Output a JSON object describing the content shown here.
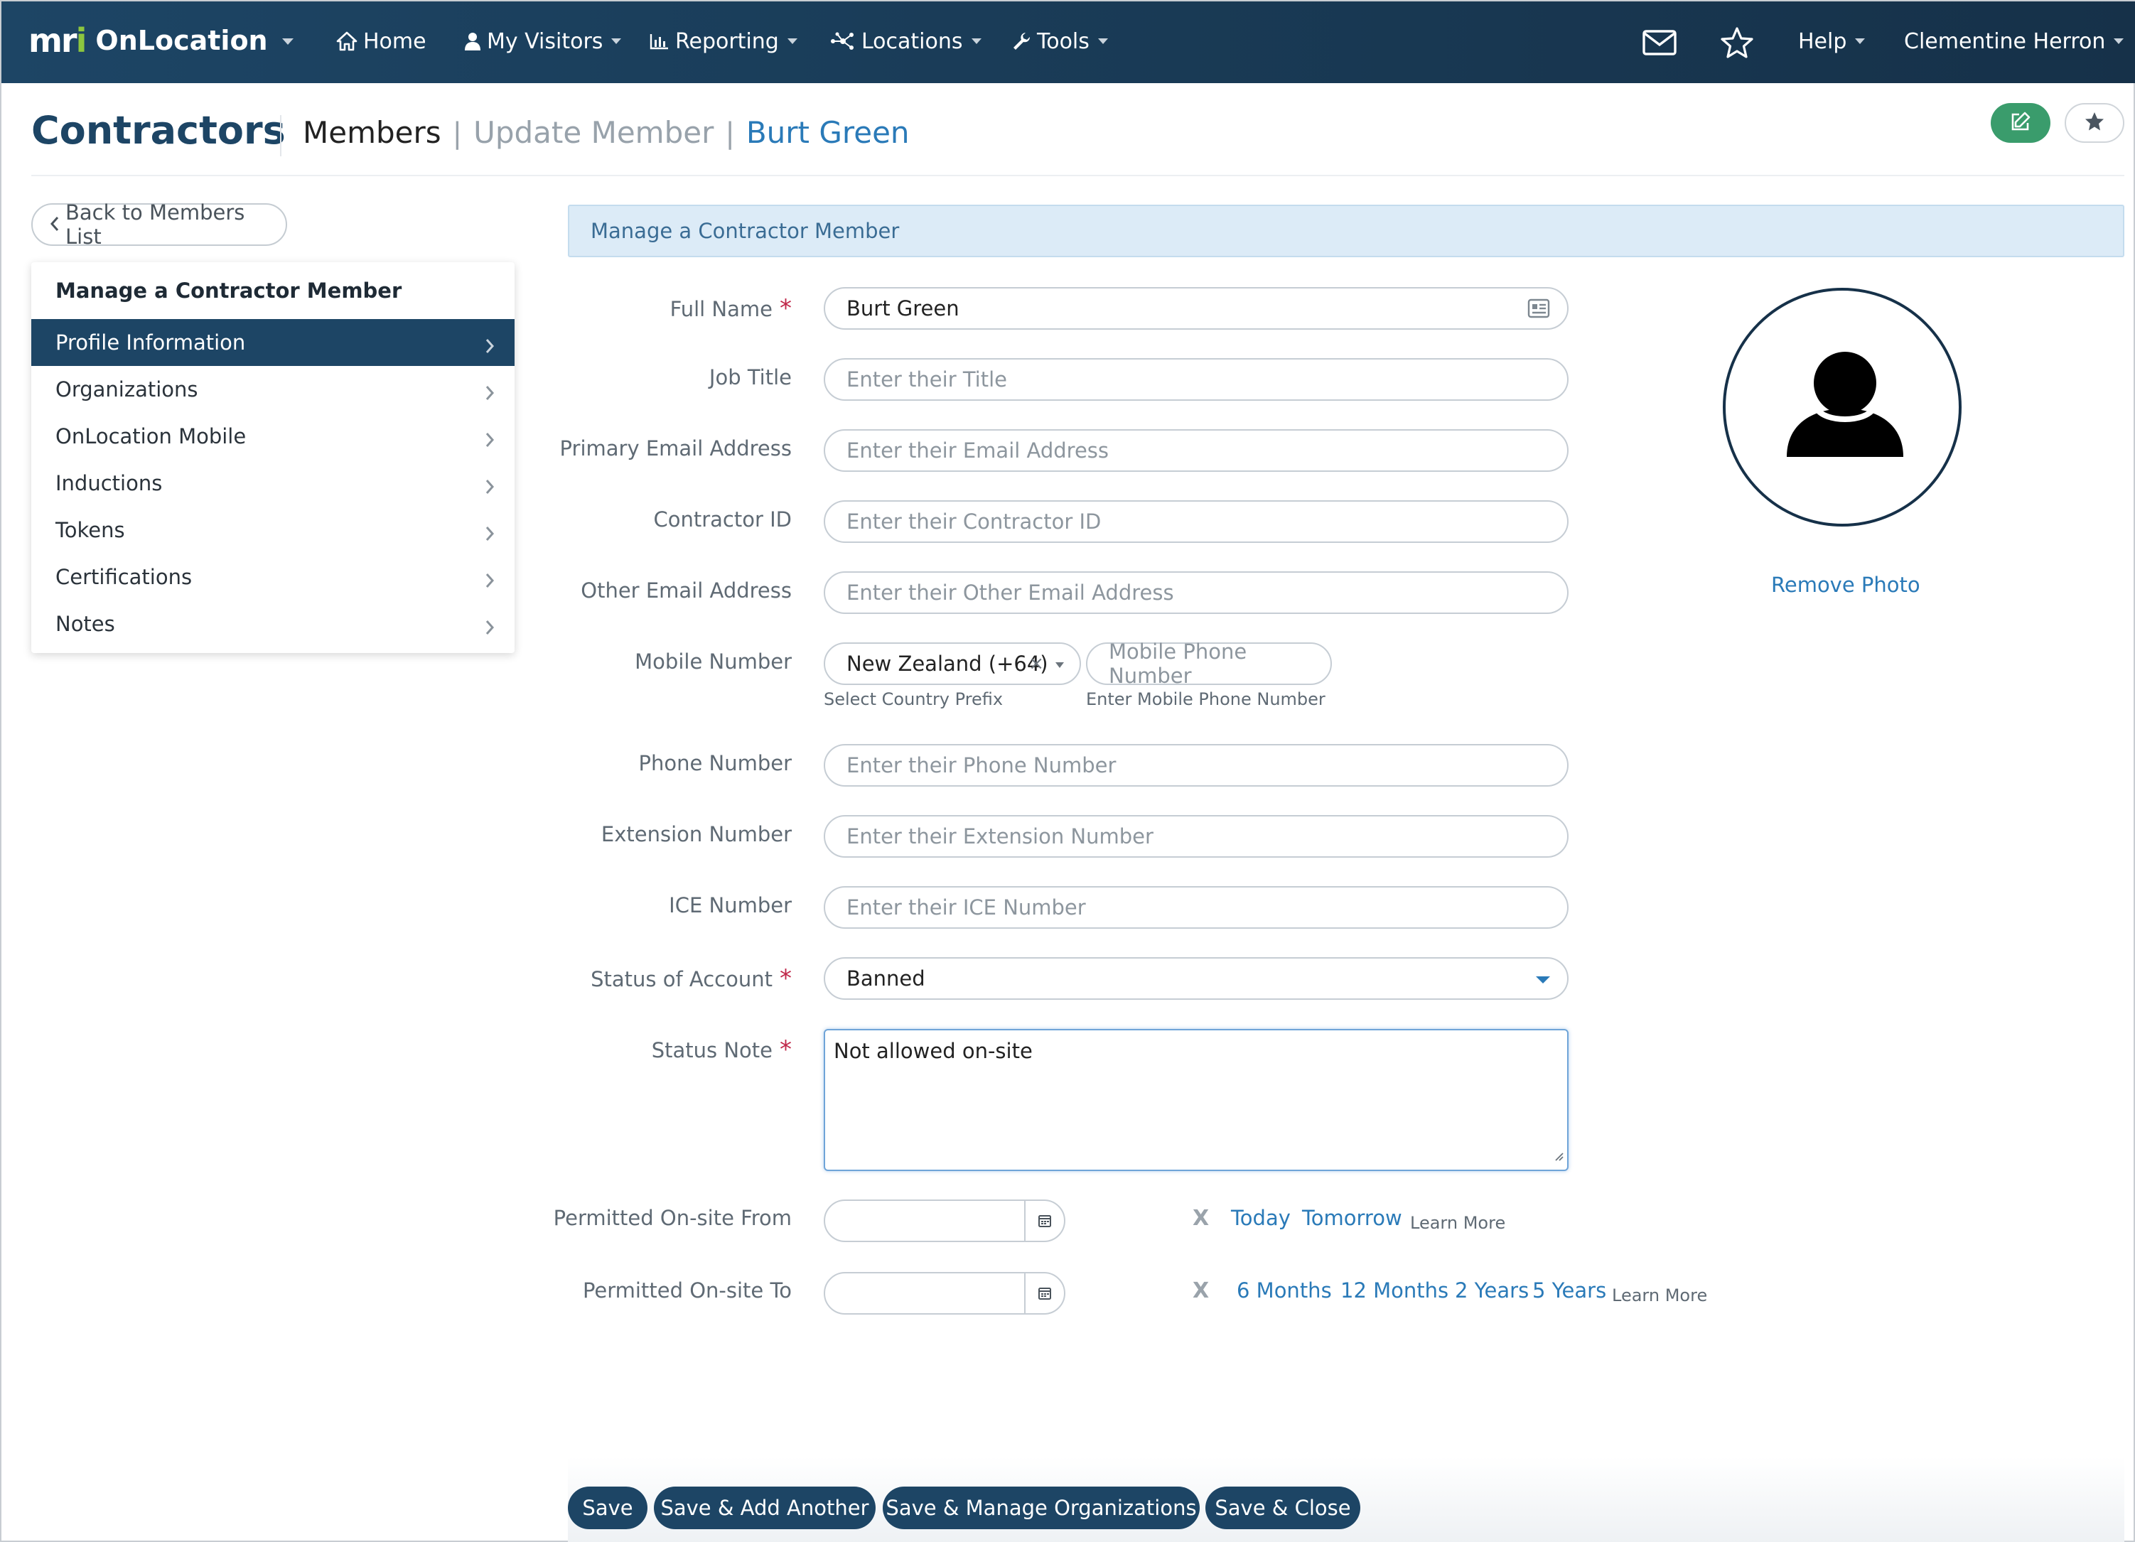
{
  "navbar": {
    "brand_logo_a": "mr",
    "brand_logo_b": "i",
    "brand_name": "OnLocation",
    "items": [
      {
        "label": "Home",
        "icon": "home-icon"
      },
      {
        "label": "My Visitors",
        "icon": "user-icon"
      },
      {
        "label": "Reporting",
        "icon": "bar-chart-icon"
      },
      {
        "label": "Locations",
        "icon": "network-icon"
      },
      {
        "label": "Tools",
        "icon": "wrench-icon"
      }
    ],
    "right": {
      "mail_icon": "envelope-icon",
      "star_icon": "star-icon",
      "help": "Help",
      "user": "Clementine Herron"
    }
  },
  "header": {
    "title": "Contractors",
    "crumb_members": "Members",
    "crumb_update": "Update Member",
    "crumb_name": "Burt Green",
    "edit_icon": "edit-icon",
    "favorite_icon": "star-icon"
  },
  "sidebar": {
    "back": "Back to Members List",
    "heading": "Manage a Contractor Member",
    "items": [
      {
        "label": "Profile Information",
        "active": true
      },
      {
        "label": "Organizations"
      },
      {
        "label": "OnLocation Mobile"
      },
      {
        "label": "Inductions"
      },
      {
        "label": "Tokens"
      },
      {
        "label": "Certifications"
      },
      {
        "label": "Notes"
      }
    ]
  },
  "form": {
    "section_title": "Manage a Contractor Member",
    "full_name": {
      "label": "Full Name",
      "value": "Burt Green"
    },
    "job_title": {
      "label": "Job Title",
      "placeholder": "Enter their Title"
    },
    "primary_email": {
      "label": "Primary Email Address",
      "placeholder": "Enter their Email Address"
    },
    "contractor_id": {
      "label": "Contractor ID",
      "placeholder": "Enter their Contractor ID"
    },
    "other_email": {
      "label": "Other Email Address",
      "placeholder": "Enter their Other Email Address"
    },
    "mobile": {
      "label": "Mobile Number",
      "country_value": "New Zealand (+64)",
      "country_hint": "Select Country Prefix",
      "phone_placeholder": "Mobile Phone Number",
      "phone_hint": "Enter Mobile Phone Number"
    },
    "phone": {
      "label": "Phone Number",
      "placeholder": "Enter their Phone Number"
    },
    "extension": {
      "label": "Extension Number",
      "placeholder": "Enter their Extension Number"
    },
    "ice": {
      "label": "ICE Number",
      "placeholder": "Enter their ICE Number"
    },
    "status": {
      "label": "Status of Account",
      "value": "Banned"
    },
    "status_note": {
      "label": "Status Note",
      "value": "Not allowed on-site"
    },
    "onsite_from": {
      "label": "Permitted On-site From",
      "clear": "X",
      "quick": [
        "Today",
        "Tomorrow"
      ],
      "learn": "Learn More"
    },
    "onsite_to": {
      "label": "Permitted On-site To",
      "clear": "X",
      "quick": [
        "6 Months",
        "12 Months",
        "2 Years",
        "5 Years"
      ],
      "learn": "Learn More"
    },
    "required_mark": "*"
  },
  "photo": {
    "avatar_icon": "person-icon",
    "remove": "Remove Photo"
  },
  "footer": {
    "save": "Save",
    "save_add": "Save & Add Another",
    "save_manage": "Save & Manage Organizations",
    "save_close": "Save & Close"
  },
  "colors": {
    "navbar": "#1d4565",
    "accent_link": "#2a7ab8",
    "required": "#c0284a",
    "edit_button": "#3a9c6c"
  }
}
